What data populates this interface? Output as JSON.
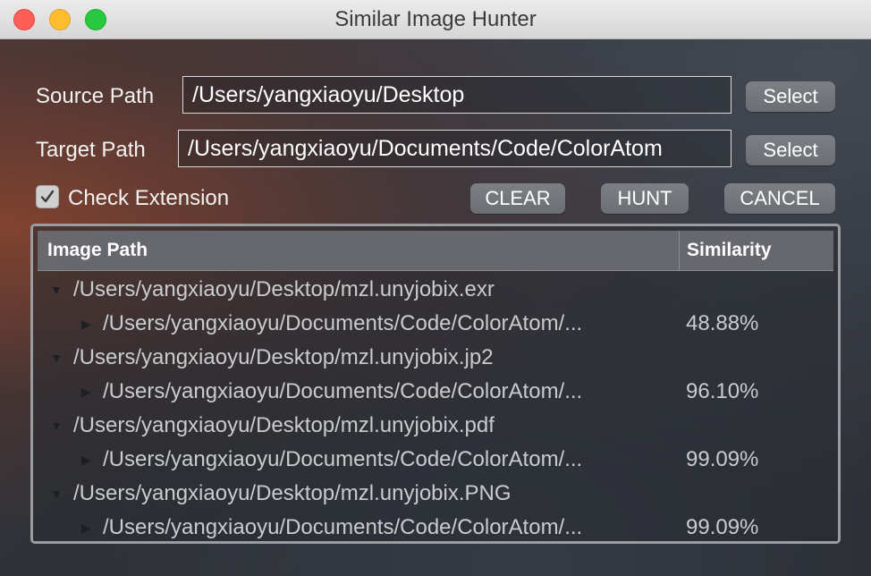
{
  "window": {
    "title": "Similar Image Hunter"
  },
  "form": {
    "source_label": "Source Path",
    "source_value": "/Users/yangxiaoyu/Desktop",
    "source_button": "Select",
    "target_label": "Target Path",
    "target_value": "/Users/yangxiaoyu/Documents/Code/ColorAtom",
    "target_button": "Select",
    "check_extension_label": "Check Extension",
    "check_extension_checked": true
  },
  "actions": {
    "clear": "CLEAR",
    "hunt": "HUNT",
    "cancel": "CANCEL"
  },
  "results": {
    "columns": [
      "Image Path",
      "Similarity"
    ],
    "rows": [
      {
        "level": 0,
        "expanded": true,
        "path": "/Users/yangxiaoyu/Desktop/mzl.unyjobix.exr",
        "similarity": ""
      },
      {
        "level": 1,
        "expanded": false,
        "path": "/Users/yangxiaoyu/Documents/Code/ColorAtom/...",
        "similarity": "48.88%"
      },
      {
        "level": 0,
        "expanded": true,
        "path": "/Users/yangxiaoyu/Desktop/mzl.unyjobix.jp2",
        "similarity": ""
      },
      {
        "level": 1,
        "expanded": false,
        "path": "/Users/yangxiaoyu/Documents/Code/ColorAtom/...",
        "similarity": "96.10%"
      },
      {
        "level": 0,
        "expanded": true,
        "path": "/Users/yangxiaoyu/Desktop/mzl.unyjobix.pdf",
        "similarity": ""
      },
      {
        "level": 1,
        "expanded": false,
        "path": "/Users/yangxiaoyu/Documents/Code/ColorAtom/...",
        "similarity": "99.09%"
      },
      {
        "level": 0,
        "expanded": true,
        "path": "/Users/yangxiaoyu/Desktop/mzl.unyjobix.PNG",
        "similarity": ""
      },
      {
        "level": 1,
        "expanded": false,
        "path": "/Users/yangxiaoyu/Documents/Code/ColorAtom/...",
        "similarity": "99.09%"
      }
    ]
  }
}
